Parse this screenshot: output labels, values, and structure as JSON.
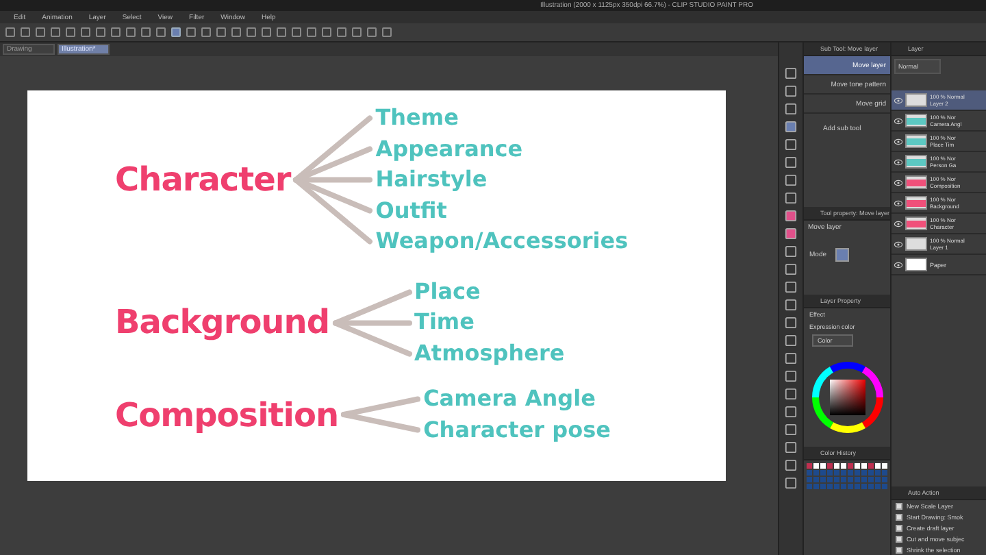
{
  "window": {
    "title": "Illustration (2000 x 1125px 350dpi 66.7%) - CLIP STUDIO PAINT PRO"
  },
  "menu": [
    "Edit",
    "Animation",
    "Layer",
    "Select",
    "View",
    "Filter",
    "Window",
    "Help"
  ],
  "document_tabs": [
    {
      "label": "Drawing",
      "selected": false
    },
    {
      "label": "Illustration*",
      "selected": true
    }
  ],
  "canvas": {
    "groups": [
      {
        "heading": "Character",
        "items": [
          "Theme",
          "Appearance",
          "Hairstyle",
          "Outfit",
          "Weapon/Accessories"
        ]
      },
      {
        "heading": "Background",
        "items": [
          "Place",
          "Time",
          "Atmosphere"
        ]
      },
      {
        "heading": "Composition",
        "items": [
          "Camera Angle",
          "Character pose"
        ]
      }
    ]
  },
  "sub_tool": {
    "title": "Sub Tool: Move layer",
    "items": [
      {
        "label": "Move layer",
        "selected": true
      },
      {
        "label": "Move tone pattern",
        "selected": false
      },
      {
        "label": "Move grid",
        "selected": false
      }
    ],
    "add_label": "Add sub tool"
  },
  "tool_property": {
    "title": "Tool property: Move layer",
    "tool_name": "Move layer",
    "mode_label": "Mode"
  },
  "layer_panel": {
    "title": "Layer",
    "blend_mode": "Normal",
    "layers": [
      {
        "kind": "raster",
        "mode": "100 % Normal",
        "name": "Layer 2",
        "selected": true
      },
      {
        "kind": "text",
        "mode": "100 % Nor",
        "name": "Camera Angl",
        "color": "#5cc8c2",
        "selected": false
      },
      {
        "kind": "text",
        "mode": "100 % Nor",
        "name": "Place Tim",
        "color": "#5cc8c2",
        "selected": false
      },
      {
        "kind": "text",
        "mode": "100 % Nor",
        "name": "Person Ga",
        "color": "#5cc8c2",
        "selected": false
      },
      {
        "kind": "text",
        "mode": "100 % Nor",
        "name": "Composition",
        "color": "#f0507a",
        "selected": false
      },
      {
        "kind": "text",
        "mode": "100 % Nor",
        "name": "Background",
        "color": "#f0507a",
        "selected": false
      },
      {
        "kind": "text",
        "mode": "100 % Nor",
        "name": "Character",
        "color": "#f0507a",
        "selected": false
      },
      {
        "kind": "raster",
        "mode": "100 % Normal",
        "name": "Layer 1",
        "selected": false
      },
      {
        "kind": "paper",
        "name": "Paper",
        "selected": false
      }
    ]
  },
  "layer_property": {
    "title": "Layer Property",
    "effect_label": "Effect",
    "expression_label": "Expression color",
    "expression_value": "Color"
  },
  "auto_action": {
    "title": "Auto Action",
    "items": [
      {
        "label": "New Scale Layer",
        "checked": true
      },
      {
        "label": "Start Drawing: Smok",
        "checked": true
      },
      {
        "label": "Create draft layer",
        "checked": true
      },
      {
        "label": "Cut and move subjec",
        "checked": true
      },
      {
        "label": "Shrink the selection",
        "checked": true
      }
    ]
  },
  "color_history": {
    "title": "Color History"
  }
}
